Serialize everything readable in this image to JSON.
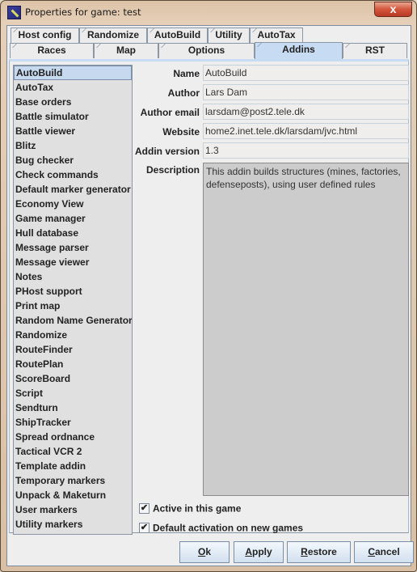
{
  "window": {
    "title": "Properties for game: test",
    "close_label": "x"
  },
  "tabs": {
    "row1": [
      "Host config",
      "Randomize",
      "AutoBuild",
      "Utility",
      "AutoTax"
    ],
    "row2": [
      "Races",
      "Map",
      "Options",
      "Addins",
      "RST"
    ],
    "active": "Addins"
  },
  "addins": {
    "selected": "AutoBuild",
    "items": [
      "AutoBuild",
      "AutoTax",
      "Base orders",
      "Battle simulator",
      "Battle viewer",
      "Blitz",
      "Bug checker",
      "Check commands",
      "Default marker generator",
      "Economy View",
      "Game manager",
      "Hull database",
      "Message parser",
      "Message viewer",
      "Notes",
      "PHost support",
      "Print map",
      "Random Name Generator",
      "Randomize",
      "RouteFinder",
      "RoutePlan",
      "ScoreBoard",
      "Script",
      "Sendturn",
      "ShipTracker",
      "Spread ordnance",
      "Tactical VCR 2",
      "Template addin",
      "Temporary markers",
      "Unpack & Maketurn",
      "User markers",
      "Utility markers"
    ]
  },
  "details": {
    "name_label": "Name",
    "name_value": "AutoBuild",
    "author_label": "Author",
    "author_value": "Lars Dam",
    "email_label": "Author email",
    "email_value": "larsdam@post2.tele.dk",
    "website_label": "Website",
    "website_value": "home2.inet.tele.dk/larsdam/jvc.html",
    "version_label": "Addin version",
    "version_value": "1.3",
    "description_label": "Description",
    "description_value": "This addin builds structures (mines, factories, defenseposts), using user defined rules"
  },
  "options": {
    "active_label": "Active in this game",
    "active_checked": true,
    "default_label": "Default activation on new games",
    "default_checked": true,
    "check_glyph": "✔"
  },
  "buttons": {
    "ok": {
      "mnemonic": "O",
      "rest": "k"
    },
    "apply": {
      "mnemonic": "A",
      "rest": "pply"
    },
    "restore": {
      "mnemonic": "R",
      "rest": "estore"
    },
    "cancel": {
      "mnemonic": "C",
      "rest": "ancel"
    }
  }
}
